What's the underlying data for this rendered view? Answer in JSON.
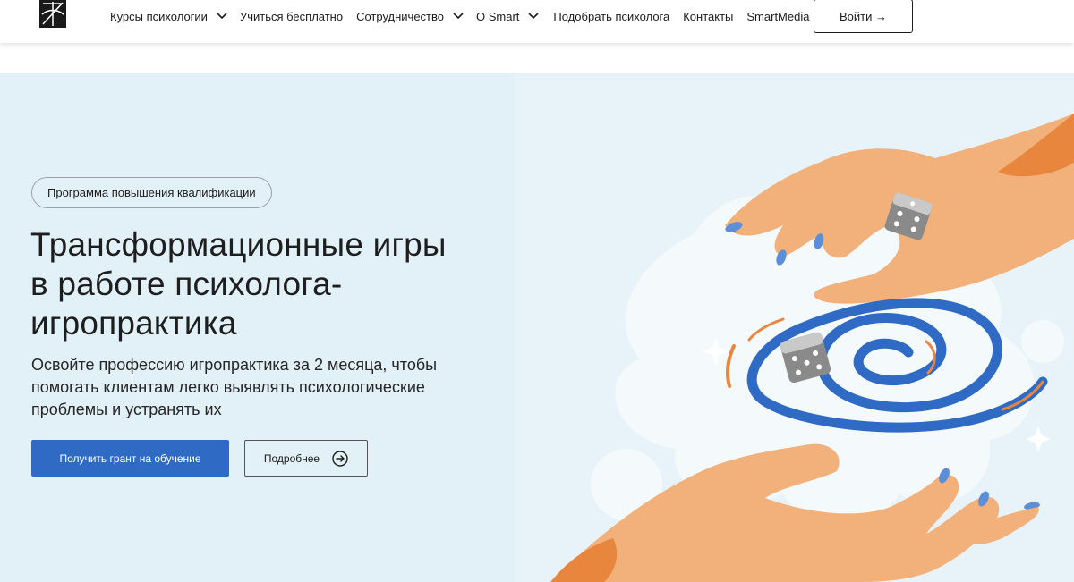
{
  "header": {
    "nav": [
      {
        "label": "Курсы психологии",
        "dropdown": true
      },
      {
        "label": "Учиться бесплатно",
        "dropdown": false
      },
      {
        "label": "Сотрудничество",
        "dropdown": true
      },
      {
        "label": "О Smart",
        "dropdown": true
      },
      {
        "label": "Подобрать психолога",
        "dropdown": false
      },
      {
        "label": "Контакты",
        "dropdown": false
      },
      {
        "label": "SmartMedia",
        "dropdown": true
      }
    ],
    "login_label": "Войти →"
  },
  "hero": {
    "badge": "Программа повышения квалификации",
    "title_lines": [
      "Трансформационные игры",
      "в работе психолога-",
      "игропрактика"
    ],
    "subtitle_lines": [
      "Освойте профессию игропрактика за 2 месяца, чтобы",
      "помогать клиентам легко выявлять психологические",
      "проблемы и устранять их"
    ],
    "primary_button": "Получить грант на обучение",
    "secondary_button": "Подробнее"
  },
  "colors": {
    "accent": "#2f6bc4",
    "hero_bg": "#e2f0f7",
    "skin": "#f2b07a",
    "skin_dark": "#e8863d",
    "nail": "#5b8fd9",
    "spiral": "#2f6bc4",
    "motion_lines": "#e8863d"
  }
}
